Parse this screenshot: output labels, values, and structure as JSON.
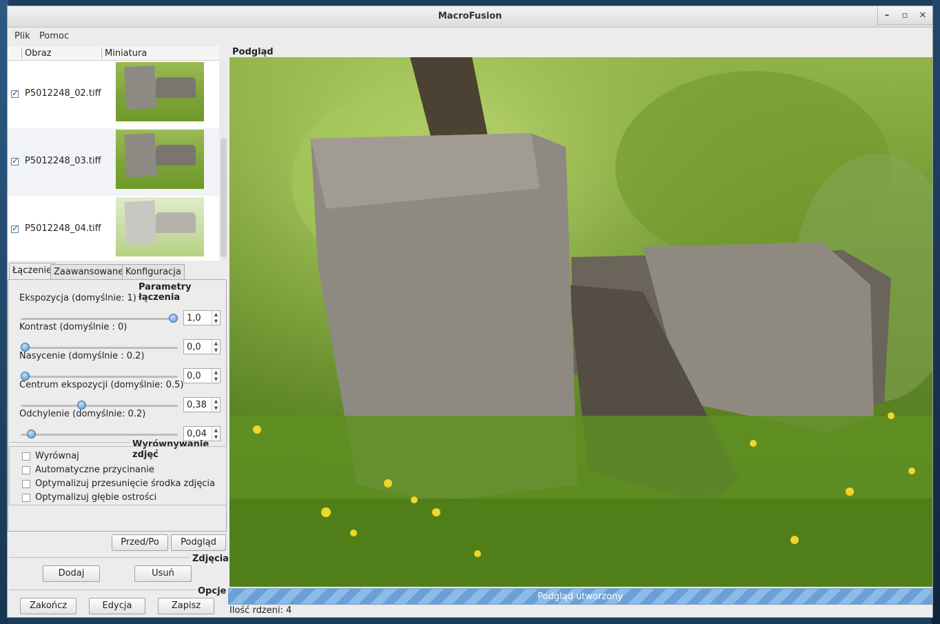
{
  "window": {
    "title": "MacroFusion"
  },
  "menu": [
    "Plik",
    "Pomoc"
  ],
  "list": {
    "columns": [
      "Obraz",
      "Miniatura"
    ],
    "items": [
      {
        "file": "P5012248_02.tiff",
        "checked": true
      },
      {
        "file": "P5012248_03.tiff",
        "checked": true
      },
      {
        "file": "P5012248_04.tiff",
        "checked": true
      }
    ]
  },
  "tabs": [
    "Łączenie",
    "Zaawansowane",
    "Konfiguracja"
  ],
  "params": {
    "title": "Parametry łączenia",
    "items": [
      {
        "label": "Ekspozycja (domyślnie: 1)",
        "value": "1,0",
        "level": 1.0
      },
      {
        "label": "Kontrast (domyślnie : 0)",
        "value": "0,0",
        "level": 0.0
      },
      {
        "label": "Nasycenie (domyślnie : 0.2)",
        "value": "0,0",
        "level": 0.0
      },
      {
        "label": "Centrum ekspozycji (domyślnie: 0.5)",
        "value": "0,38",
        "level": 0.38
      },
      {
        "label": "Odchylenie (domyślnie: 0.2)",
        "value": "0,04",
        "level": 0.04
      }
    ]
  },
  "align": {
    "title": "Wyrównywanie zdjęć",
    "options": [
      {
        "label": "Wyrównaj",
        "checked": false
      },
      {
        "label": "Automatyczne przycinanie",
        "checked": false
      },
      {
        "label": "Optymalizuj przesunięcie środka zdjęcia",
        "checked": false
      },
      {
        "label": "Optymalizuj głębie ostrości",
        "checked": false
      }
    ]
  },
  "buttons": {
    "before_after": "Przed/Po",
    "preview": "Podgląd"
  },
  "photos": {
    "title": "Zdjęcia",
    "add": "Dodaj",
    "remove": "Usuń"
  },
  "options": {
    "title": "Opcje",
    "quit": "Zakończ",
    "edit": "Edycja",
    "save": "Zapisz"
  },
  "preview": {
    "label": "Podgląd"
  },
  "progress": {
    "text": "Podgląd utworzony",
    "fraction": 1.0
  },
  "status": {
    "cores": "Ilość rdzeni: 4"
  },
  "icons": [
    "minimize-icon",
    "maximize-icon",
    "close-icon"
  ],
  "colors": {
    "accent": "#5a96d2",
    "window_bg": "#ececec"
  }
}
